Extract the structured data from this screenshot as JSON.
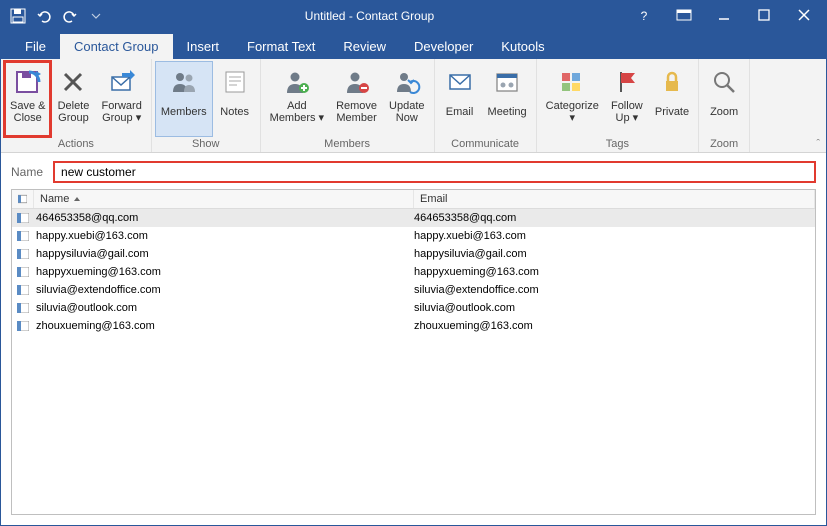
{
  "titlebar": {
    "title": "Untitled  -  Contact Group"
  },
  "tabs": {
    "file": "File",
    "contact_group": "Contact Group",
    "insert": "Insert",
    "format_text": "Format Text",
    "review": "Review",
    "developer": "Developer",
    "kutools": "Kutools"
  },
  "ribbon": {
    "actions": {
      "label": "Actions",
      "save_close": "Save &\nClose",
      "delete_group": "Delete\nGroup",
      "forward_group": "Forward\nGroup ▾"
    },
    "show": {
      "label": "Show",
      "members": "Members",
      "notes": "Notes"
    },
    "members": {
      "label": "Members",
      "add_members": "Add\nMembers ▾",
      "remove_member": "Remove\nMember",
      "update_now": "Update\nNow"
    },
    "communicate": {
      "label": "Communicate",
      "email": "Email",
      "meeting": "Meeting"
    },
    "tags": {
      "label": "Tags",
      "categorize": "Categorize\n▾",
      "follow_up": "Follow\nUp ▾",
      "private": "Private"
    },
    "zoom": {
      "label": "Zoom",
      "zoom": "Zoom"
    }
  },
  "name_row": {
    "label": "Name",
    "value": "new customer"
  },
  "columns": {
    "name": "Name",
    "email": "Email"
  },
  "rows": [
    {
      "name": "464653358@qq.com",
      "email": "464653358@qq.com"
    },
    {
      "name": "happy.xuebi@163.com",
      "email": "happy.xuebi@163.com"
    },
    {
      "name": "happysiluvia@gail.com",
      "email": "happysiluvia@gail.com"
    },
    {
      "name": "happyxueming@163.com",
      "email": "happyxueming@163.com"
    },
    {
      "name": "siluvia@extendoffice.com",
      "email": "siluvia@extendoffice.com"
    },
    {
      "name": "siluvia@outlook.com",
      "email": "siluvia@outlook.com"
    },
    {
      "name": "zhouxueming@163.com",
      "email": "zhouxueming@163.com"
    }
  ]
}
